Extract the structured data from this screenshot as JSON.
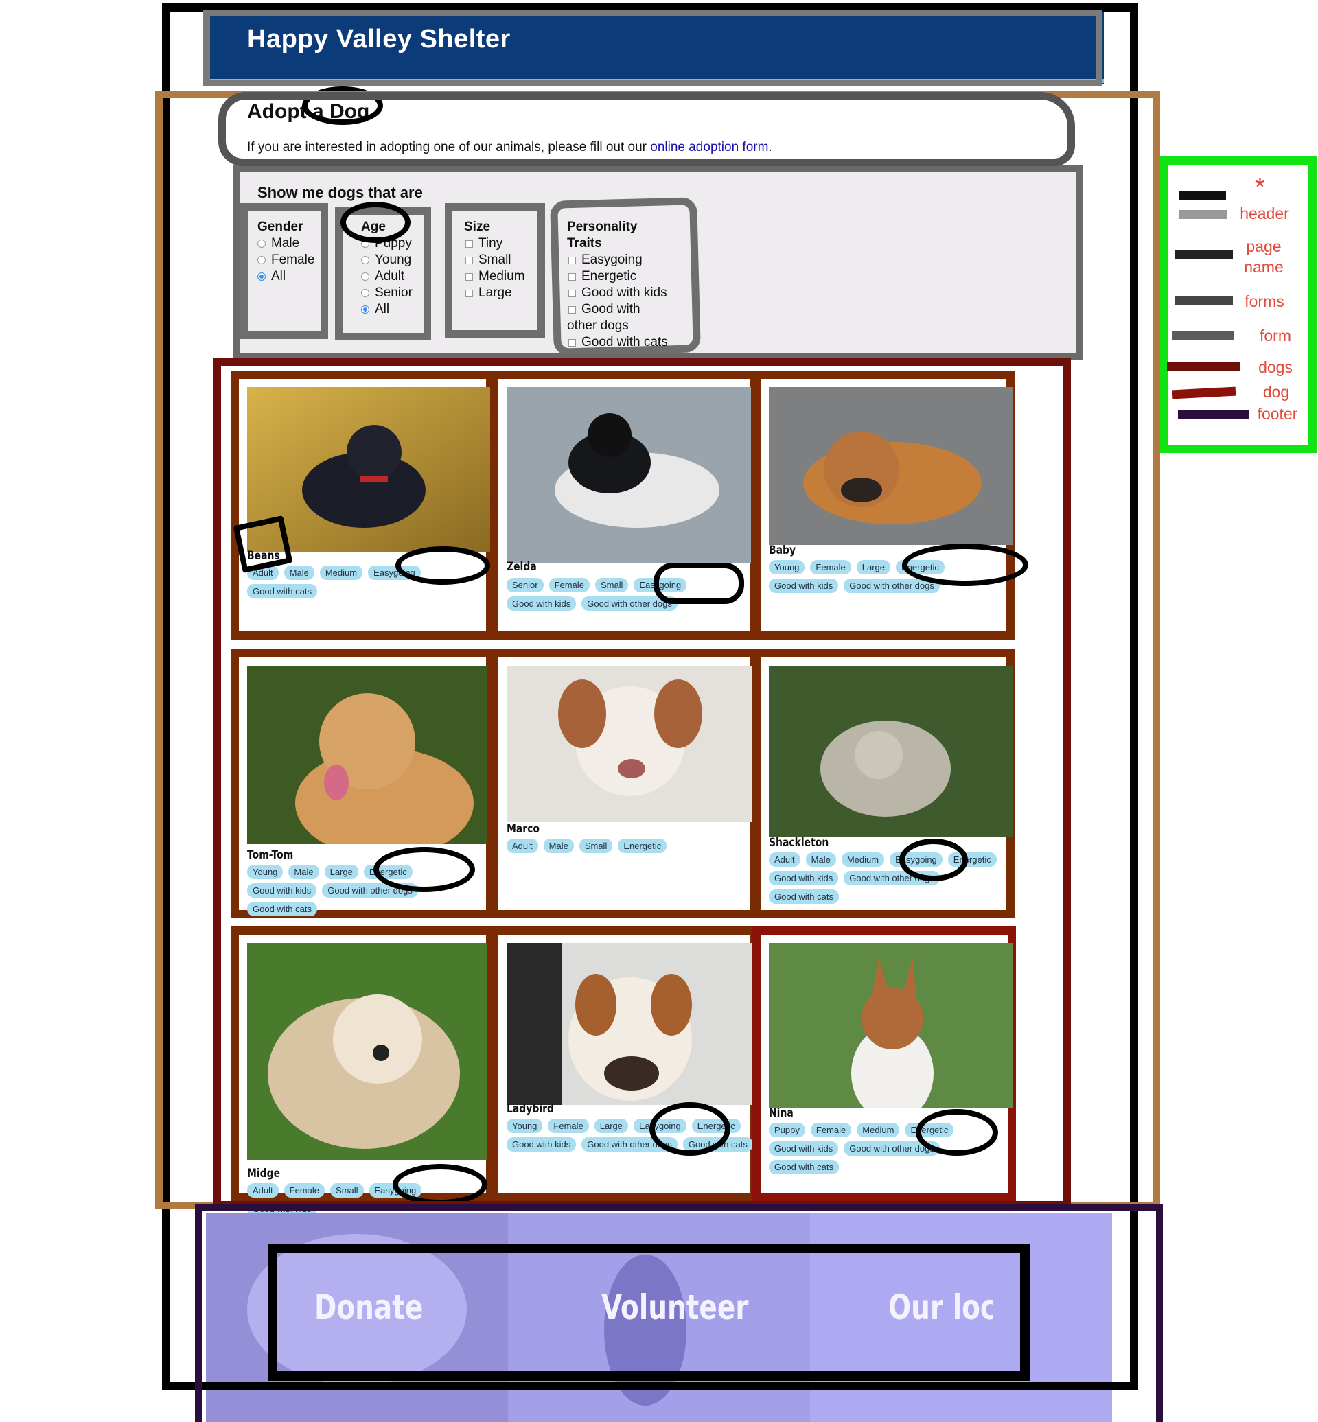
{
  "header": {
    "title": "Happy Valley Shelter"
  },
  "page": {
    "heading": "Adopt a Dog",
    "intro_text": "If you are interested in adopting one of our animals, please fill out our",
    "intro_link": "online adoption form",
    "intro_end": "."
  },
  "filters": {
    "title": "Show me dogs that are",
    "gender": {
      "label": "Gender",
      "options": [
        "Male",
        "Female",
        "All"
      ],
      "selected": "All"
    },
    "age": {
      "label": "Age",
      "options": [
        "Puppy",
        "Young",
        "Adult",
        "Senior",
        "All"
      ],
      "selected": "All"
    },
    "size": {
      "label": "Size",
      "options": [
        "Tiny",
        "Small",
        "Medium",
        "Large"
      ]
    },
    "traits": {
      "label_line1": "Personality",
      "label_line2": "Traits",
      "options": [
        "Easygoing",
        "Energetic",
        "Good with kids",
        "Good with",
        "other dogs",
        "Good with cats"
      ]
    }
  },
  "dogs": [
    {
      "name": "Beans",
      "tags": [
        "Adult",
        "Male",
        "Medium",
        "Easygoing",
        "Good with cats"
      ]
    },
    {
      "name": "Zelda",
      "tags": [
        "Senior",
        "Female",
        "Small",
        "Easygoing",
        "Good with kids",
        "Good with other dogs"
      ]
    },
    {
      "name": "Baby",
      "tags": [
        "Young",
        "Female",
        "Large",
        "Energetic",
        "Good with kids",
        "Good with other dogs"
      ]
    },
    {
      "name": "Tom-Tom",
      "tags": [
        "Young",
        "Male",
        "Large",
        "Energetic",
        "Good with kids",
        "Good with other dogs",
        "Good with cats"
      ]
    },
    {
      "name": "Marco",
      "tags": [
        "Adult",
        "Male",
        "Small",
        "Energetic"
      ]
    },
    {
      "name": "Shackleton",
      "tags": [
        "Adult",
        "Male",
        "Medium",
        "Easygoing",
        "Energetic",
        "Good with kids",
        "Good with other dogs",
        "Good with cats"
      ]
    },
    {
      "name": "Midge",
      "tags": [
        "Adult",
        "Female",
        "Small",
        "Easygoing",
        "Good with kids"
      ]
    },
    {
      "name": "Ladybird",
      "tags": [
        "Young",
        "Female",
        "Large",
        "Easygoing",
        "Energetic",
        "Good with kids",
        "Good with other dogs",
        "Good with cats"
      ]
    },
    {
      "name": "Nina",
      "tags": [
        "Puppy",
        "Female",
        "Medium",
        "Energetic",
        "Good with kids",
        "Good with other dogs",
        "Good with cats"
      ]
    }
  ],
  "footer": {
    "links": [
      "Donate",
      "Volunteer",
      "Our location"
    ]
  },
  "legend": {
    "star": "*",
    "items": [
      "header",
      "page name",
      "forms",
      "form",
      "dogs",
      "dog",
      "footer"
    ]
  },
  "colors": {
    "header_bg": "#0b3b78",
    "tag_bg": "#a9ddf0",
    "footer_bg": "#a6a1ee",
    "legend_text": "#e24a3c",
    "legend_border": "#12e312"
  }
}
